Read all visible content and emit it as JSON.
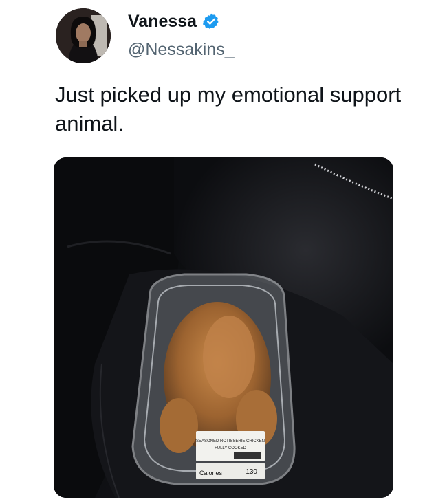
{
  "tweet": {
    "display_name": "Vanessa",
    "handle": "@Nessakins_",
    "text": "Just picked up my emotional support animal.",
    "verified": true,
    "verified_icon": "verified-badge-icon",
    "verified_color": "#1d9bf0"
  },
  "media": {
    "label_title": "SEASONED ROTISSERIE CHICKEN",
    "label_sub": "FULLY COOKED",
    "calories_label": "Calories",
    "calories_value": "130"
  }
}
